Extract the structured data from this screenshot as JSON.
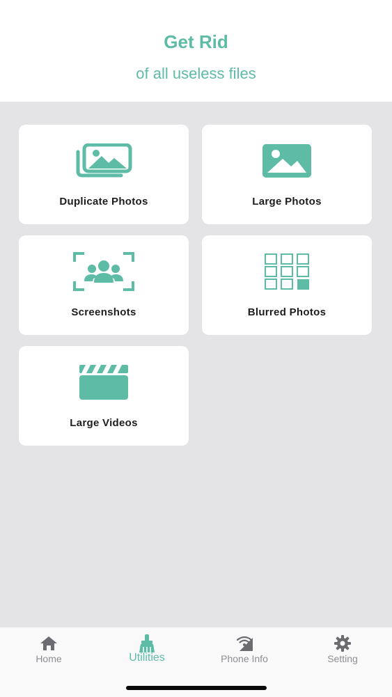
{
  "header": {
    "title": "Get Rid",
    "subtitle": "of all useless files"
  },
  "accent_color": "#5dbba6",
  "background_color": "#e4e3e6",
  "cards": [
    {
      "label": "Duplicate Photos",
      "icon": "duplicate-photos-icon"
    },
    {
      "label": "Large Photos",
      "icon": "large-photo-icon"
    },
    {
      "label": "Screenshots",
      "icon": "screenshot-group-icon"
    },
    {
      "label": "Blurred Photos",
      "icon": "grid-blur-icon"
    },
    {
      "label": "Large Videos",
      "icon": "clapperboard-icon"
    }
  ],
  "tabbar": {
    "active": "Utilities",
    "tabs": [
      {
        "label": "Home",
        "icon": "home-icon"
      },
      {
        "label": "Utilities",
        "icon": "broom-icon"
      },
      {
        "label": "Phone Info",
        "icon": "signal-icon"
      },
      {
        "label": "Setting",
        "icon": "gear-icon"
      }
    ]
  }
}
